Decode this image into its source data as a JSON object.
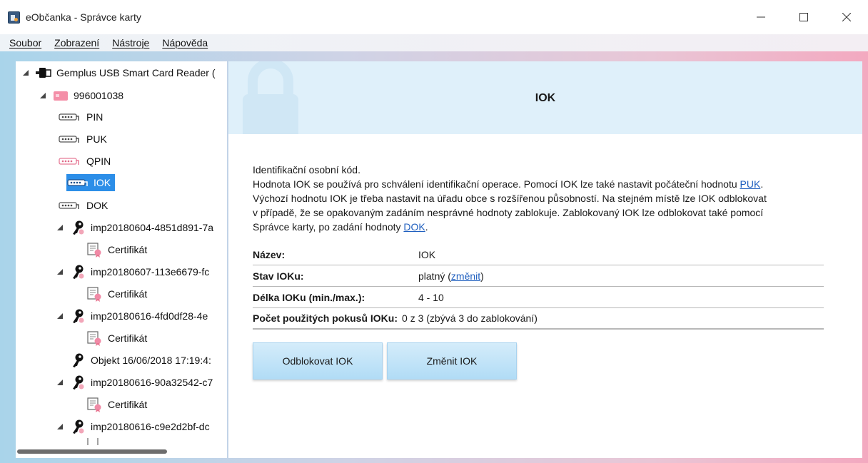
{
  "window": {
    "title": "eObčanka - Správce karty",
    "minimize_glyph": "—",
    "maximize_glyph": "☐",
    "close_glyph": "✕"
  },
  "menu": [
    {
      "label": "Soubor"
    },
    {
      "label": "Zobrazení"
    },
    {
      "label": "Nástroje"
    },
    {
      "label": "Nápověda"
    }
  ],
  "tree": {
    "reader": {
      "label": "Gemplus USB Smart Card Reader (",
      "icon": "card-reader-icon"
    },
    "card": {
      "label": "996001038",
      "icon": "smart-card-icon"
    },
    "codes": [
      {
        "label": "PIN",
        "icon": "pin-pad-icon"
      },
      {
        "label": "PUK",
        "icon": "pin-pad-icon"
      },
      {
        "label": "QPIN",
        "icon": "pin-pad-pink-icon"
      },
      {
        "label": "IOK",
        "icon": "pin-pad-icon",
        "selected": true
      },
      {
        "label": "DOK",
        "icon": "pin-pad-icon"
      }
    ],
    "keys": [
      {
        "label": "imp20180604-4851d891-7a",
        "child": "Certifikát"
      },
      {
        "label": "imp20180607-113e6679-fc",
        "child": "Certifikát"
      },
      {
        "label": "imp20180616-4fd0df28-4e",
        "child": "Certifikát"
      },
      {
        "label": "Objekt 16/06/2018 17:19:4:",
        "child": null
      },
      {
        "label": "imp20180616-90a32542-c7",
        "child": "Certifikát"
      },
      {
        "label": "imp20180616-c9e2d2bf-dc",
        "child": null
      }
    ]
  },
  "main": {
    "title": "IOK",
    "description": {
      "line1": "Identifikační osobní kód.",
      "line2_pre": "Hodnota IOK se používá pro schválení identifikační operace. Pomocí IOK lze také nastavit počáteční hodnotu ",
      "line2_link": "PUK",
      "line2_post": ".",
      "line3": "Výchozí hodnotu IOK je třeba nastavit na úřadu obce s rozšířenou působností. Na stejném místě lze IOK odblokovat",
      "line4": "v případě, že se opakovaným zadáním nesprávné hodnoty zablokuje. Zablokovaný IOK lze odblokovat také pomocí",
      "line5_pre": "Správce karty, po zadání hodnoty ",
      "line5_link": "DOK",
      "line5_post": "."
    },
    "properties": {
      "name_label": "Název:",
      "name_value": "IOK",
      "status_label": "Stav IOKu:",
      "status_value": "platný",
      "status_open": " (",
      "status_link": "změnit",
      "status_close": ")",
      "length_label": "Délka IOKu (min./max.):",
      "length_value": "4 - 10",
      "attempts_label": "Počet použitých pokusů IOKu:",
      "attempts_value": "0 z 3 (zbývá 3 do zablokování)"
    },
    "buttons": {
      "unblock": "Odblokovat IOK",
      "change": "Změnit IOK"
    }
  },
  "colors": {
    "selection": "#2c8ee8",
    "header_band": "#dff0fa",
    "link": "#1f5fbf",
    "button": "#b1dcf6"
  }
}
